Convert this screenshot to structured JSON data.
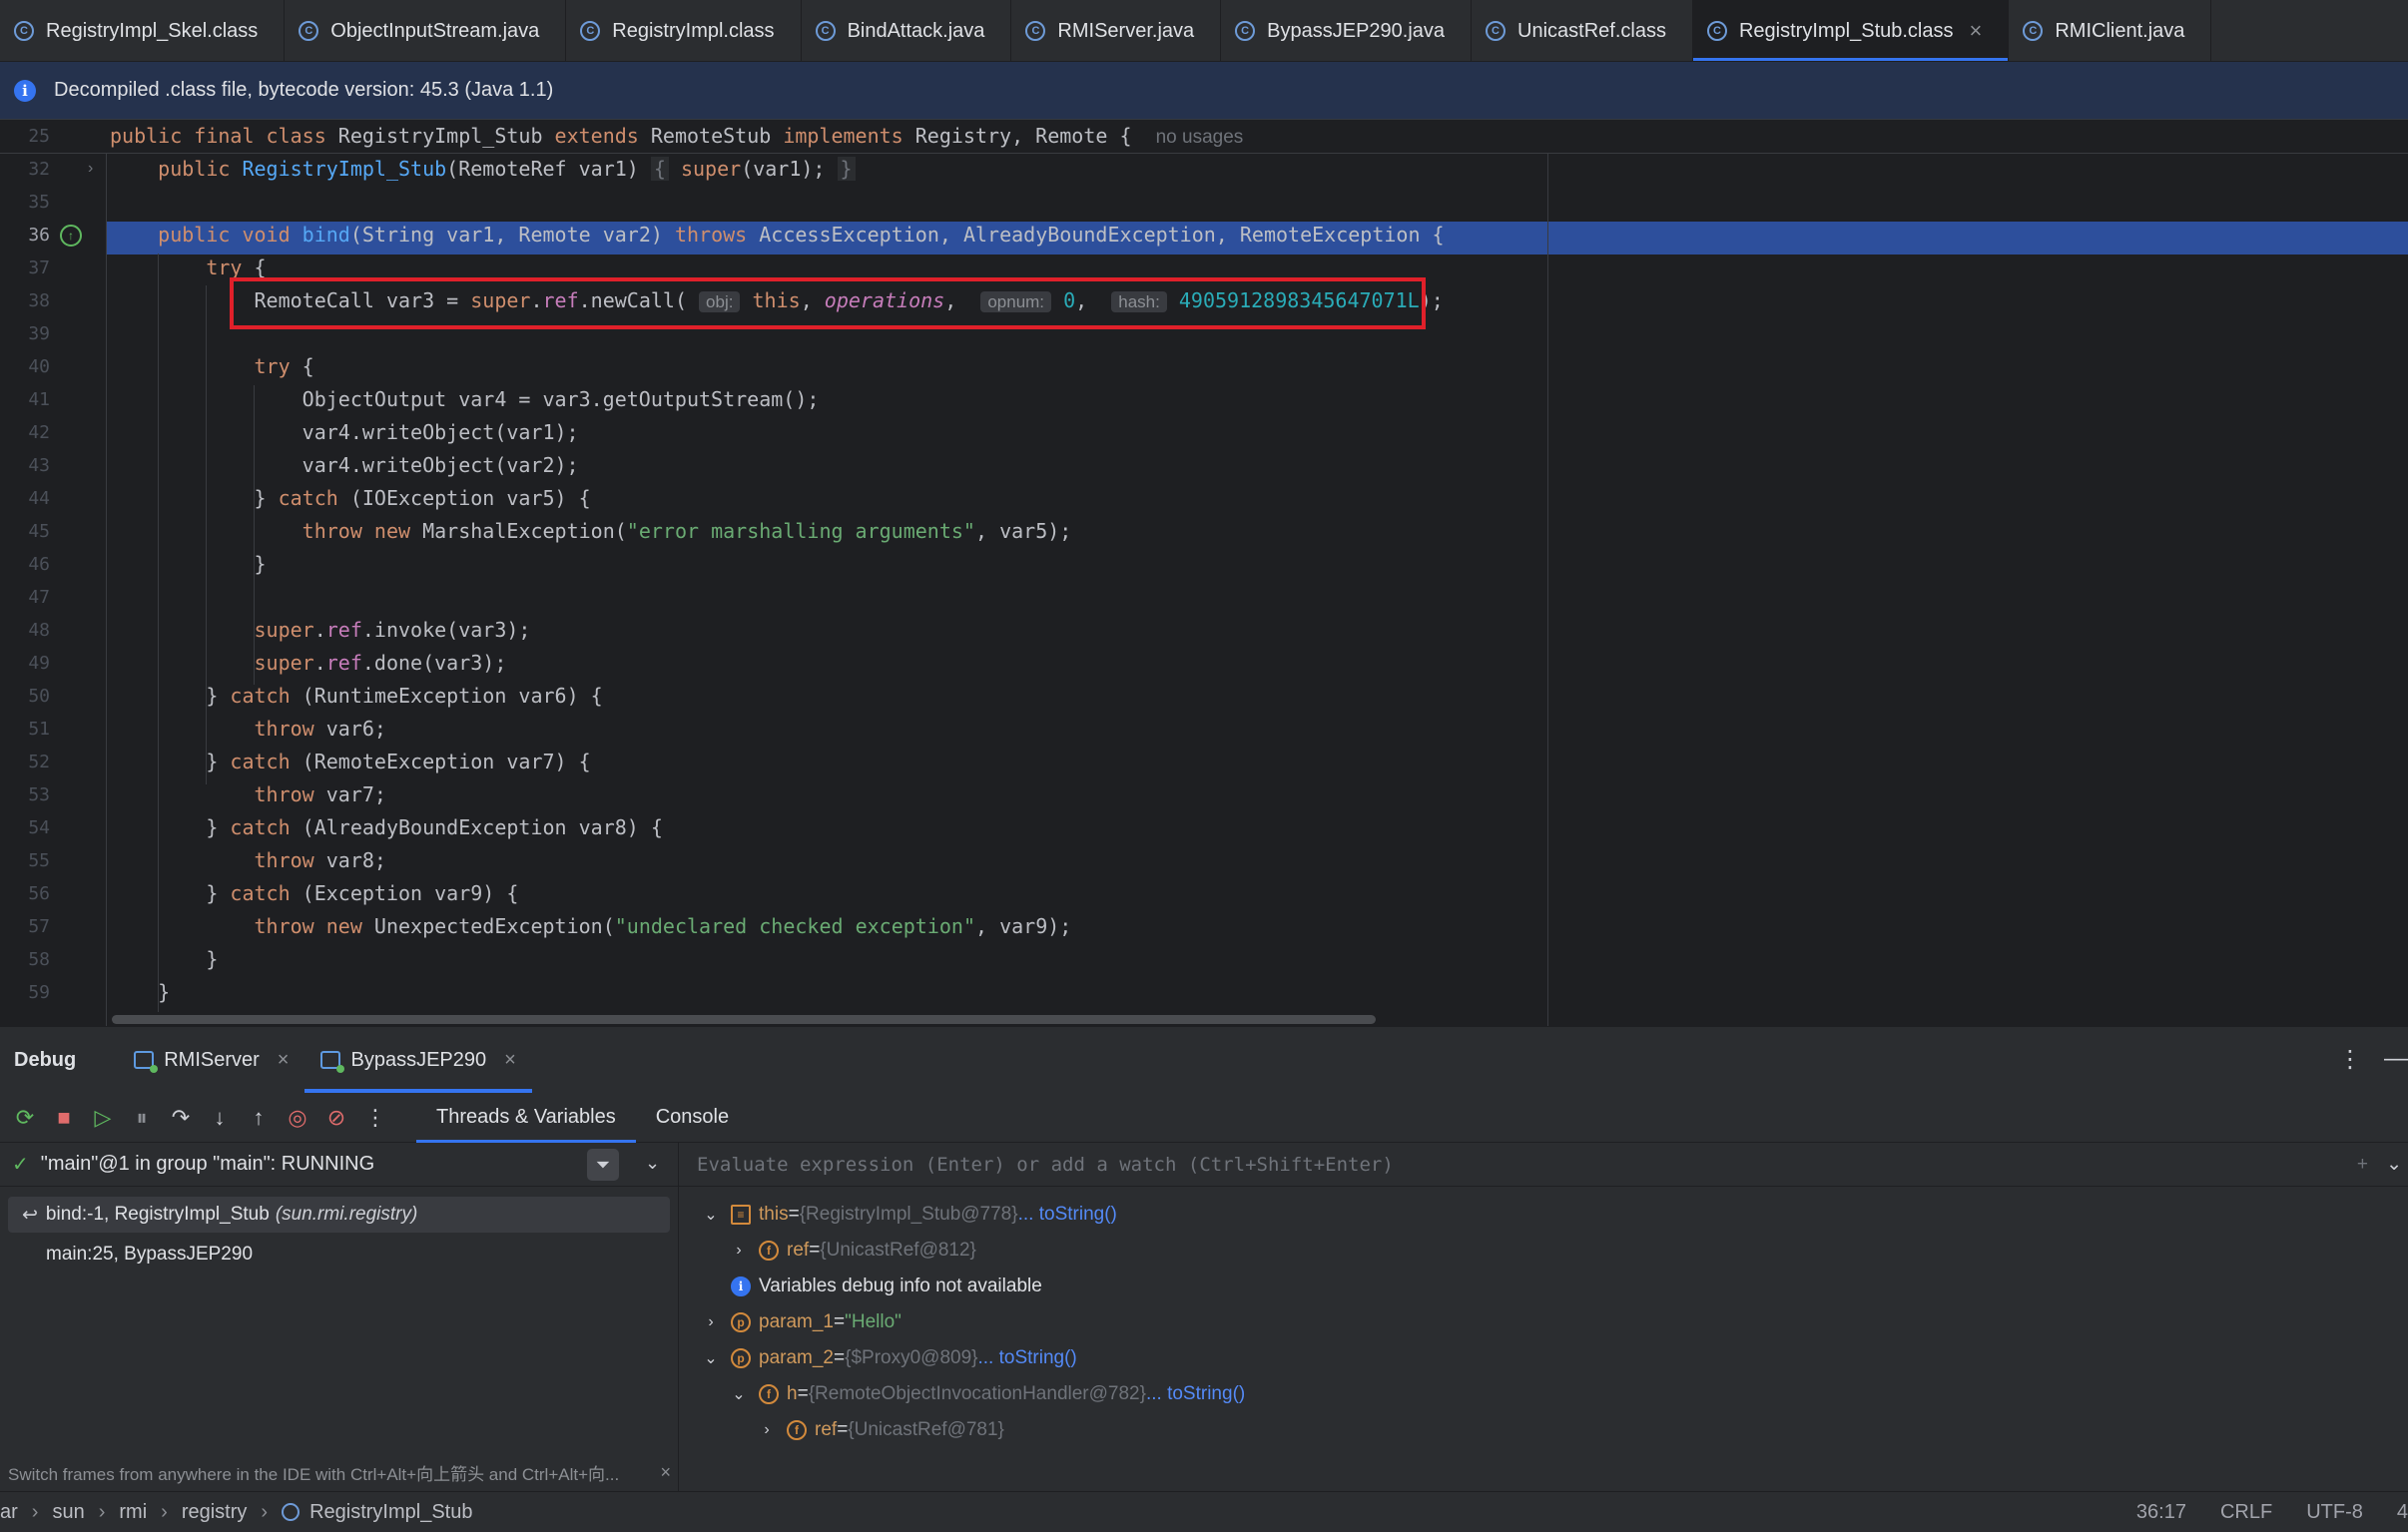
{
  "tabs": [
    {
      "label": "RegistryImpl_Skel.class",
      "kind": "class"
    },
    {
      "label": "ObjectInputStream.java",
      "kind": "java"
    },
    {
      "label": "RegistryImpl.class",
      "kind": "class"
    },
    {
      "label": "BindAttack.java",
      "kind": "java"
    },
    {
      "label": "RMIServer.java",
      "kind": "java"
    },
    {
      "label": "BypassJEP290.java",
      "kind": "java"
    },
    {
      "label": "UnicastRef.class",
      "kind": "class"
    },
    {
      "label": "RegistryImpl_Stub.class",
      "kind": "class",
      "active": true
    },
    {
      "label": "RMIClient.java",
      "kind": "java"
    }
  ],
  "banner": {
    "text": "Decompiled .class file, bytecode version: 45.3 (Java 1.1)"
  },
  "editor": {
    "line_numbers": [
      "25",
      "32",
      "35",
      "36",
      "37",
      "38",
      "39",
      "40",
      "41",
      "42",
      "43",
      "44",
      "45",
      "46",
      "47",
      "48",
      "49",
      "50",
      "51",
      "52",
      "53",
      "54",
      "55",
      "56",
      "57",
      "58",
      "59"
    ],
    "sticky_usages": "no usages",
    "hints": {
      "obj": "obj:",
      "opnum": "opnum:",
      "hash": "hash:"
    }
  },
  "debug": {
    "title": "Debug",
    "sessions": [
      {
        "label": "RMIServer"
      },
      {
        "label": "BypassJEP290",
        "active": true
      }
    ],
    "subtabs": [
      "Threads & Variables",
      "Console"
    ],
    "thread": "\"main\"@1 in group \"main\": RUNNING",
    "frames": [
      {
        "method": "bind:-1, RegistryImpl_Stub",
        "pkg": "(sun.rmi.registry)"
      },
      {
        "method": "main:25, BypassJEP290",
        "pkg": ""
      }
    ],
    "frames_hint": "Switch frames from anywhere in the IDE with Ctrl+Alt+向上箭头 and Ctrl+Alt+向...",
    "eval_placeholder": "Evaluate expression (Enter) or add a watch (Ctrl+Shift+Enter)",
    "variables": [
      {
        "name": "this",
        "eq": " = ",
        "type": "{RegistryImpl_Stub@778}",
        "link": " ... toString()"
      },
      {
        "name": "ref",
        "eq": " = ",
        "type": "{UnicastRef@812}",
        "link": ""
      },
      {
        "name": "Variables debug info not available",
        "eq": "",
        "type": "",
        "link": ""
      },
      {
        "name": "param_1",
        "eq": " = ",
        "type": "\"Hello\"",
        "link": ""
      },
      {
        "name": "param_2",
        "eq": " = ",
        "type": "{$Proxy0@809}",
        "link": " ... toString()"
      },
      {
        "name": "h",
        "eq": " = ",
        "type": "{RemoteObjectInvocationHandler@782}",
        "link": " ... toString()"
      },
      {
        "name": "ref",
        "eq": " = ",
        "type": "{UnicastRef@781}",
        "link": ""
      }
    ]
  },
  "status": {
    "crumbs": [
      "ar",
      "sun",
      "rmi",
      "registry",
      "RegistryImpl_Stub"
    ],
    "position": "36:17",
    "line_sep": "CRLF",
    "encoding": "UTF-8",
    "indent": "4"
  },
  "colors": {
    "accent": "#3574f0",
    "highlight_row": "#2d4f9c",
    "red_box": "#e0202a"
  }
}
